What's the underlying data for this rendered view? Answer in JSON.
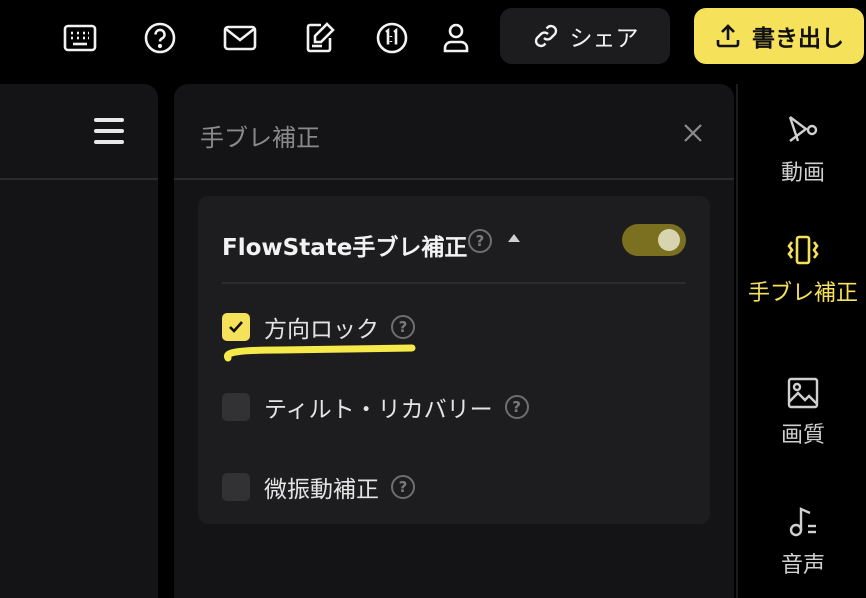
{
  "topbar": {
    "icons": [
      "keyboard-icon",
      "help-circle-icon",
      "mail-icon",
      "edit-note-icon",
      "one-to-one-icon",
      "user-icon"
    ],
    "share_label": "シェア",
    "export_label": "書き出し"
  },
  "panel": {
    "title": "手ブレ補正"
  },
  "stabilization": {
    "title": "FlowState手ブレ補正",
    "enabled": true,
    "options": [
      {
        "label": "方向ロック",
        "checked": true
      },
      {
        "label": "ティルト・リカバリー",
        "checked": false
      },
      {
        "label": "微振動補正",
        "checked": false
      }
    ],
    "help_glyph": "?"
  },
  "sidebar": {
    "items": [
      {
        "label": "動画",
        "icon": "video-icon",
        "active": false
      },
      {
        "label": "手ブレ補正",
        "icon": "vibration-icon",
        "active": true
      },
      {
        "label": "画質",
        "icon": "image-icon",
        "active": false
      },
      {
        "label": "音声",
        "icon": "music-note-icon",
        "active": false
      }
    ]
  },
  "colors": {
    "accent": "#f6e15a",
    "toggle_on": "#7a7020",
    "background": "#000000",
    "panel": "#141416"
  }
}
